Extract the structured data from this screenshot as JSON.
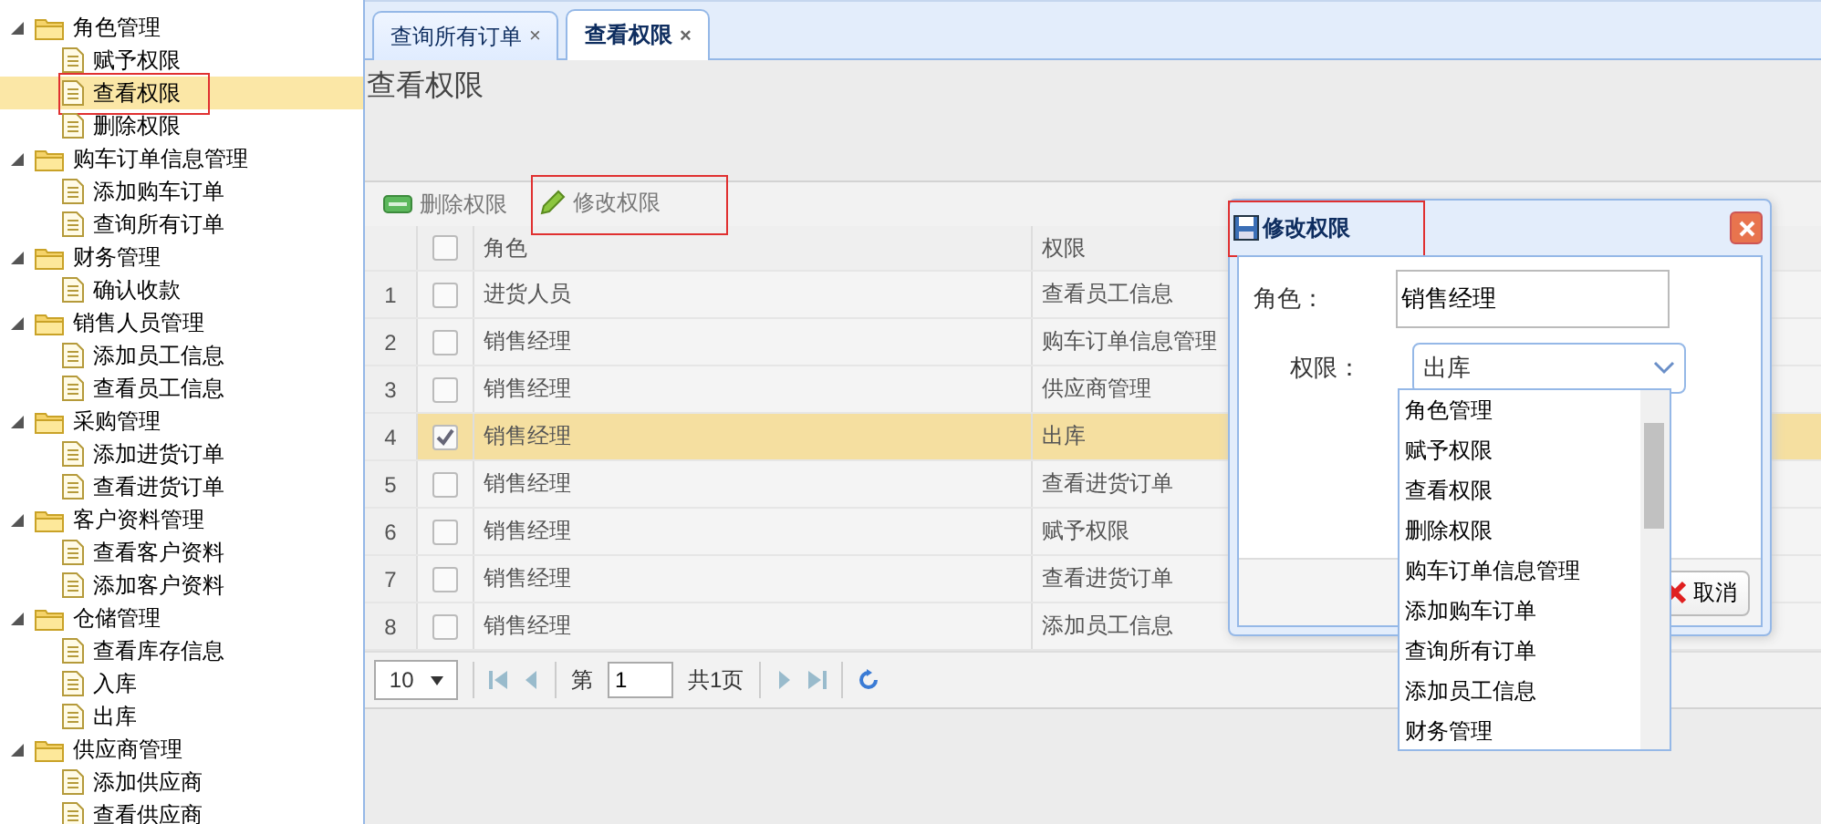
{
  "sidebar": {
    "tree": [
      {
        "label": "角色管理",
        "expanded": true,
        "children": [
          {
            "label": "赋予权限",
            "selected": false,
            "marked": false
          },
          {
            "label": "查看权限",
            "selected": true,
            "marked": true
          },
          {
            "label": "删除权限",
            "selected": false,
            "marked": false
          }
        ]
      },
      {
        "label": "购车订单信息管理",
        "expanded": true,
        "children": [
          {
            "label": "添加购车订单",
            "selected": false,
            "marked": false
          },
          {
            "label": "查询所有订单",
            "selected": false,
            "marked": false
          }
        ]
      },
      {
        "label": "财务管理",
        "expanded": true,
        "children": [
          {
            "label": "确认收款",
            "selected": false,
            "marked": false
          }
        ]
      },
      {
        "label": "销售人员管理",
        "expanded": true,
        "children": [
          {
            "label": "添加员工信息",
            "selected": false,
            "marked": false
          },
          {
            "label": "查看员工信息",
            "selected": false,
            "marked": false
          }
        ]
      },
      {
        "label": "采购管理",
        "expanded": true,
        "children": [
          {
            "label": "添加进货订单",
            "selected": false,
            "marked": false
          },
          {
            "label": "查看进货订单",
            "selected": false,
            "marked": false
          }
        ]
      },
      {
        "label": "客户资料管理",
        "expanded": true,
        "children": [
          {
            "label": "查看客户资料",
            "selected": false,
            "marked": false
          },
          {
            "label": "添加客户资料",
            "selected": false,
            "marked": false
          }
        ]
      },
      {
        "label": "仓储管理",
        "expanded": true,
        "children": [
          {
            "label": "查看库存信息",
            "selected": false,
            "marked": false
          },
          {
            "label": "入库",
            "selected": false,
            "marked": false
          },
          {
            "label": "出库",
            "selected": false,
            "marked": false
          }
        ]
      },
      {
        "label": "供应商管理",
        "expanded": true,
        "children": [
          {
            "label": "添加供应商",
            "selected": false,
            "marked": false
          },
          {
            "label": "查看供应商",
            "selected": false,
            "marked": false
          }
        ]
      }
    ]
  },
  "tabs": [
    {
      "label": "查询所有订单",
      "close": "×",
      "selected": false
    },
    {
      "label": "查看权限",
      "close": "×",
      "selected": true
    }
  ],
  "panel": {
    "title": "查看权限"
  },
  "toolbar": [
    {
      "label": "删除权限",
      "kind": "delete",
      "marked": false
    },
    {
      "label": "修改权限",
      "kind": "edit",
      "marked": true
    }
  ],
  "grid": {
    "columns": [
      "角色",
      "权限"
    ],
    "header_checked": false,
    "rows": [
      {
        "number": "1",
        "checked": false,
        "selected": false,
        "role": "进货人员",
        "permission": "查看员工信息"
      },
      {
        "number": "2",
        "checked": false,
        "selected": false,
        "role": "销售经理",
        "permission": "购车订单信息管理"
      },
      {
        "number": "3",
        "checked": false,
        "selected": false,
        "role": "销售经理",
        "permission": "供应商管理"
      },
      {
        "number": "4",
        "checked": true,
        "selected": true,
        "role": "销售经理",
        "permission": "出库"
      },
      {
        "number": "5",
        "checked": false,
        "selected": false,
        "role": "销售经理",
        "permission": "查看进货订单"
      },
      {
        "number": "6",
        "checked": false,
        "selected": false,
        "role": "销售经理",
        "permission": "赋予权限"
      },
      {
        "number": "7",
        "checked": false,
        "selected": false,
        "role": "销售经理",
        "permission": "查看进货订单"
      },
      {
        "number": "8",
        "checked": false,
        "selected": false,
        "role": "销售经理",
        "permission": "添加员工信息"
      }
    ]
  },
  "pager": {
    "page_size": "10",
    "page_label": "第",
    "page": "1",
    "total": "共1页"
  },
  "dialog": {
    "title": "修改权限",
    "marked": true,
    "role_label": "角色：",
    "role_value": "销售经理",
    "permission_label": "权限：",
    "permission_value": "出库",
    "options": [
      {
        "label": "角色管理",
        "selected": false
      },
      {
        "label": "赋予权限",
        "selected": false
      },
      {
        "label": "查看权限",
        "selected": false
      },
      {
        "label": "删除权限",
        "selected": false
      },
      {
        "label": "购车订单信息管理",
        "selected": false
      },
      {
        "label": "添加购车订单",
        "selected": false
      },
      {
        "label": "查询所有订单",
        "selected": false
      },
      {
        "label": "添加员工信息",
        "selected": false
      },
      {
        "label": "财务管理",
        "selected": false
      }
    ],
    "buttons": [
      "取消"
    ]
  }
}
